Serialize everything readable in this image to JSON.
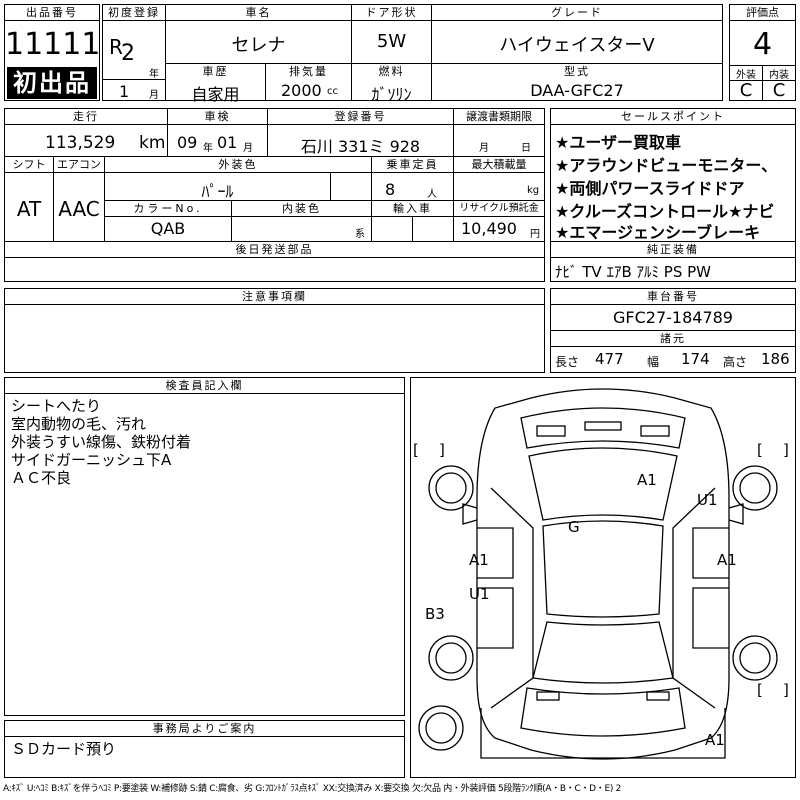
{
  "lot": {
    "header": "出品番号",
    "number": "11111",
    "first_listing": "初出品"
  },
  "registration": {
    "header": "初度登録",
    "era": "R",
    "year": "2",
    "year_unit": "年",
    "history_header": "車歴",
    "month": "1",
    "month_unit": "月"
  },
  "car": {
    "name_header": "車名",
    "name": "セレナ",
    "usage": "自家用",
    "displacement_header": "排気量",
    "displacement": "2000",
    "displacement_unit": "cc",
    "door_header": "ドア形状",
    "door": "5W",
    "fuel_header": "燃料",
    "fuel": "ｶﾞｿﾘﾝ",
    "grade_header": "グレード",
    "grade": "ハイウェイスターV",
    "model_header": "型式",
    "model": "DAA-GFC27"
  },
  "rating": {
    "header": "評価点",
    "score": "4",
    "exterior_header": "外装",
    "exterior": "C",
    "interior_header": "内装",
    "interior": "C"
  },
  "mileage": {
    "header": "走行",
    "value": "113,529",
    "unit": "km"
  },
  "inspection": {
    "header": "車検",
    "year": "09",
    "year_unit": "年",
    "month": "01",
    "month_unit": "月"
  },
  "plate": {
    "header": "登録番号",
    "value": "石川 331ミ 928"
  },
  "transfer": {
    "header": "譲渡書類期限",
    "month_unit": "月",
    "day_unit": "日"
  },
  "specs": {
    "shift_header": "シフト",
    "shift": "AT",
    "ac_header": "エアコン",
    "ac": "AAC",
    "exterior_color_header": "外装色",
    "exterior_color": "ﾊﾟｰﾙ",
    "capacity_header": "乗車定員",
    "capacity": "8",
    "capacity_unit": "人",
    "load_header": "最大積載量",
    "load_unit": "kg",
    "color_no_header": "カラーNo.",
    "color_no": "QAB",
    "interior_color_header": "内装色",
    "interior_color_unit": "系",
    "import_header": "輸入車",
    "recycle_header": "リサイクル預託金",
    "recycle": "10,490",
    "recycle_unit": "円"
  },
  "later_parts": {
    "header": "後日発送部品"
  },
  "notes": {
    "header": "注意事項欄"
  },
  "sales_points": {
    "header": "セールスポイント",
    "items": [
      "★ユーザー買取車",
      "★アラウンドビューモニター、",
      "★両側パワースライドドア",
      "★クルーズコントロール★ナビ",
      "★エマージェンシーブレーキ"
    ]
  },
  "equipment": {
    "header": "純正装備",
    "value": "ﾅﾋﾞ TV ｴｱB ｱﾙﾐ PS PW"
  },
  "chassis": {
    "header": "車台番号",
    "value": "GFC27-184789"
  },
  "dimensions": {
    "header": "諸元",
    "length_label": "長さ",
    "length": "477",
    "width_label": "幅",
    "width": "174",
    "height_label": "高さ",
    "height": "186"
  },
  "inspector": {
    "header": "検査員記入欄",
    "lines": [
      "シートへたり",
      "室内動物の毛、汚れ",
      "外装うすい線傷、鉄粉付着",
      "サイドガーニッシュ下A",
      "ＡＣ不良"
    ]
  },
  "office": {
    "header": "事務局よりご案内",
    "message": "ＳＤカード預り"
  },
  "diagram": {
    "marks": {
      "roof": "A1",
      "right_front": "U1",
      "glass": "G",
      "left_door": "A1",
      "right_door": "A1",
      "left_rear": "U1",
      "left_bumper": "B3",
      "rear": "A1"
    },
    "bracket_open": "[",
    "bracket_close": "]"
  },
  "legend": "A:ｷｽﾞ U:ﾍｺﾐ B:ｷｽﾞを伴うﾍｺﾐ P:要塗装 W:補修跡 S:錆 C:腐食、劣 G:ﾌﾛﾝﾄｶﾞﾗｽ点ｷｽﾞ XX:交換済み X:要交換 欠:欠品 内・外装評価 5段階ﾗﾝｸ順(A・B・C・D・E) 2"
}
